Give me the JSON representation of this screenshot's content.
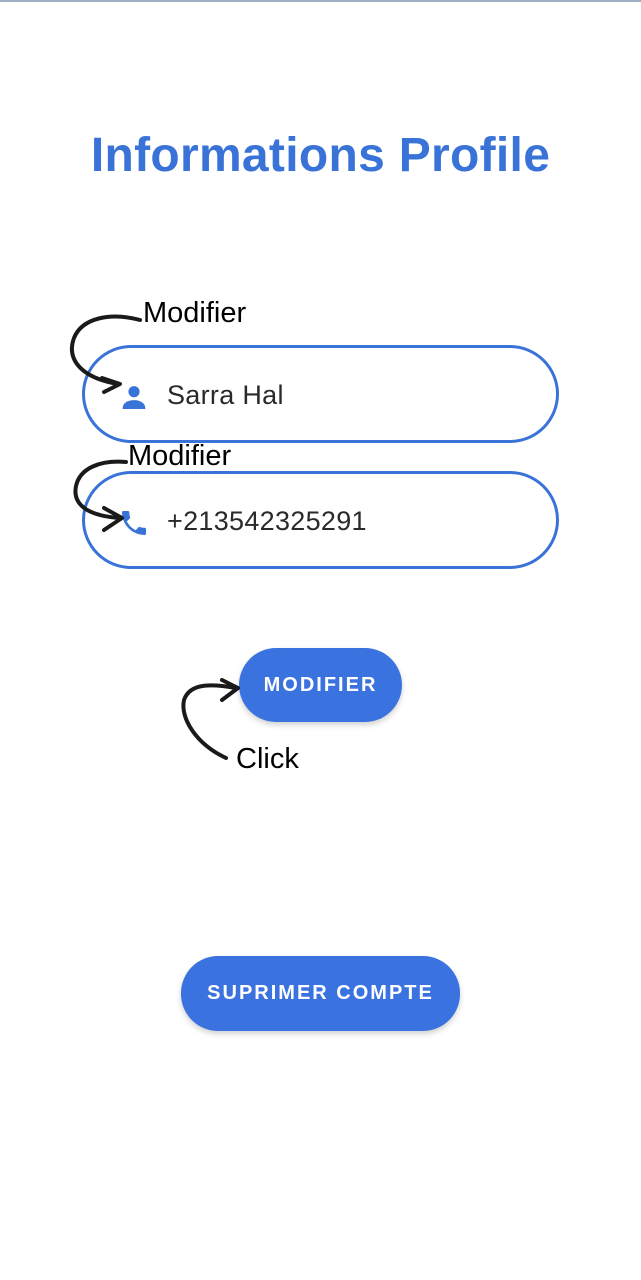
{
  "header": {
    "title": "Informations Profile"
  },
  "fields": {
    "name": {
      "value": "Sarra Hal",
      "icon": "person-icon"
    },
    "phone": {
      "value": "+213542325291",
      "icon": "phone-icon"
    }
  },
  "buttons": {
    "modify_label": "MODIFIER",
    "delete_label": "SUPRIMER COMPTE"
  },
  "annotations": {
    "name_note": "Modifier",
    "phone_note": "Modifier",
    "button_note": "Click"
  },
  "colors": {
    "accent": "#3a73d8",
    "button": "#3a73e0",
    "text": "#2a2a2a"
  }
}
